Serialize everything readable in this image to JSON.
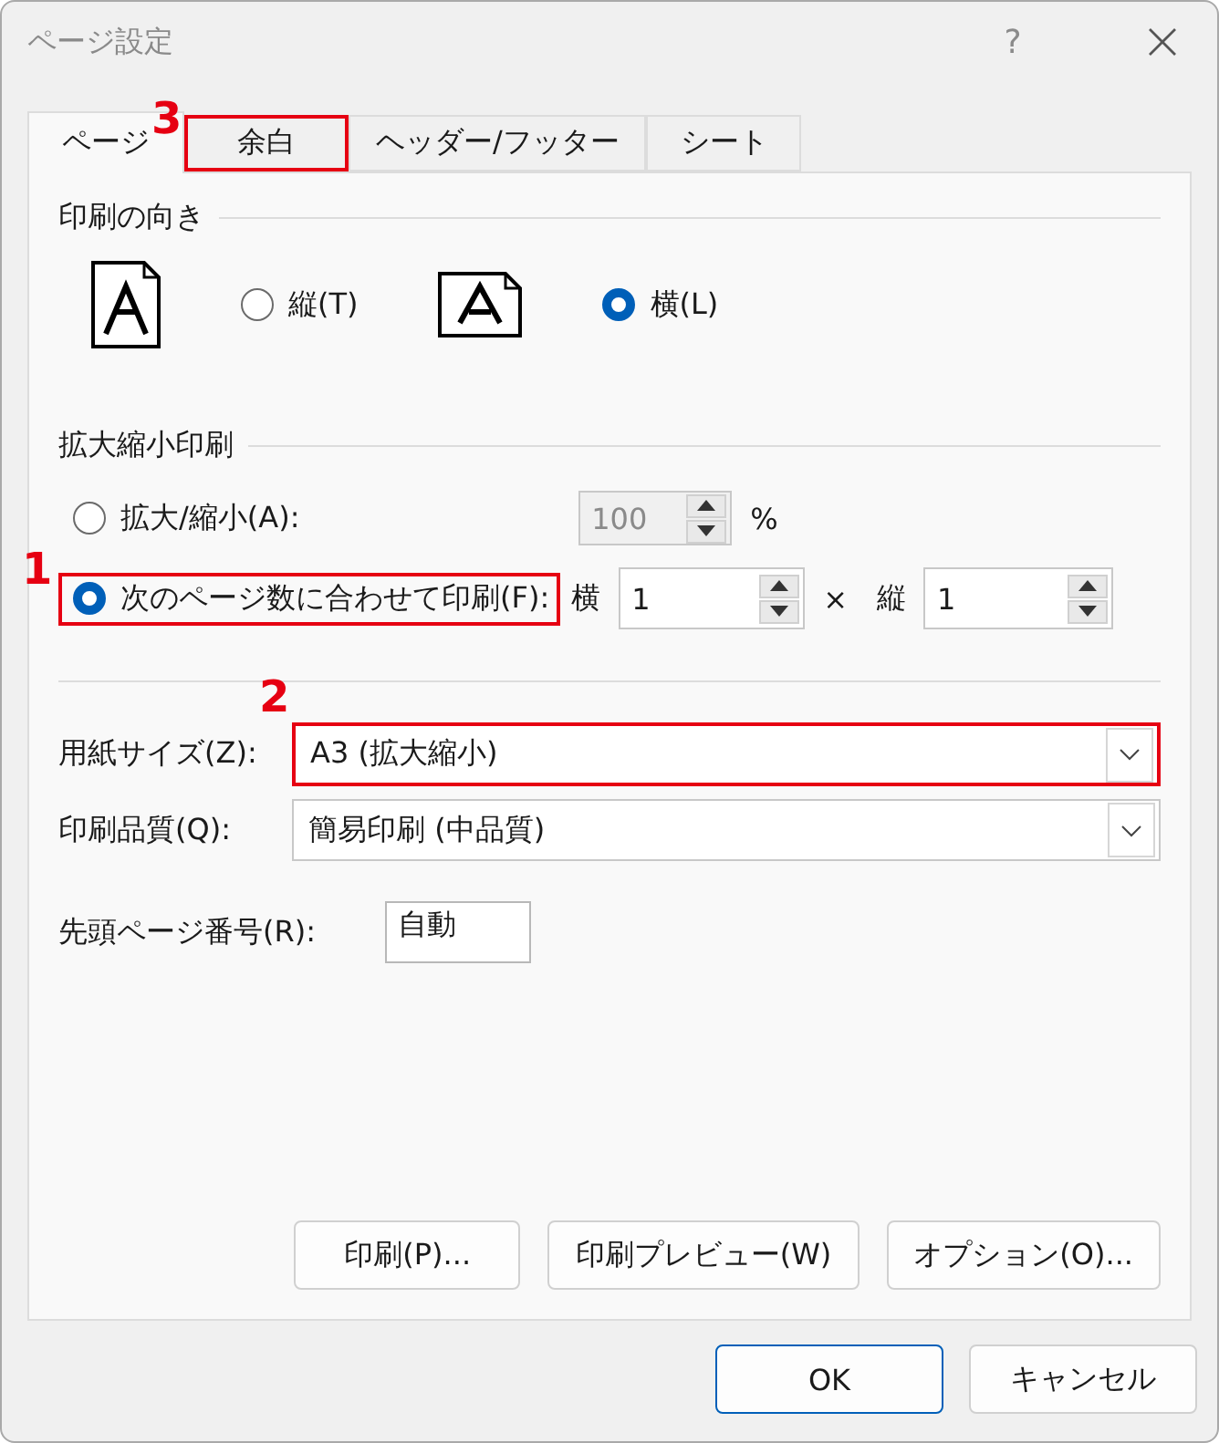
{
  "window": {
    "title": "ページ設定",
    "help": "?"
  },
  "tabs": [
    {
      "label": "ページ",
      "selected": true
    },
    {
      "label": "余白",
      "selected": false,
      "callout": "3"
    },
    {
      "label": "ヘッダー/フッター",
      "selected": false
    },
    {
      "label": "シート",
      "selected": false
    }
  ],
  "orientation": {
    "title": "印刷の向き",
    "options": [
      {
        "label": "縦(T)",
        "selected": false,
        "kind": "portrait"
      },
      {
        "label": "横(L)",
        "selected": true,
        "kind": "landscape"
      }
    ]
  },
  "scaling": {
    "title": "拡大縮小印刷",
    "options": [
      {
        "label": "拡大/縮小(A):",
        "selected": false
      },
      {
        "label": "次のページ数に合わせて印刷(F):",
        "selected": true,
        "callout": "1"
      }
    ],
    "percent": {
      "value": "100",
      "disabled": true,
      "unit": "%"
    },
    "fit": {
      "wide_label": "横",
      "wide": "1",
      "times": "×",
      "tall_label": "縦",
      "tall": "1"
    }
  },
  "paper": [
    {
      "label": "用紙サイズ(Z):",
      "value": "A3 (拡大縮小)",
      "callout": "2"
    },
    {
      "label": "印刷品質(Q):",
      "value": "簡易印刷 (中品質)"
    }
  ],
  "first_page": {
    "label": "先頭ページ番号(R):",
    "value": "自動"
  },
  "actions": [
    "印刷(P)...",
    "印刷プレビュー(W)",
    "オプション(O)..."
  ],
  "buttons": [
    {
      "label": "OK",
      "default": true
    },
    {
      "label": "キャンセル",
      "default": false
    }
  ]
}
